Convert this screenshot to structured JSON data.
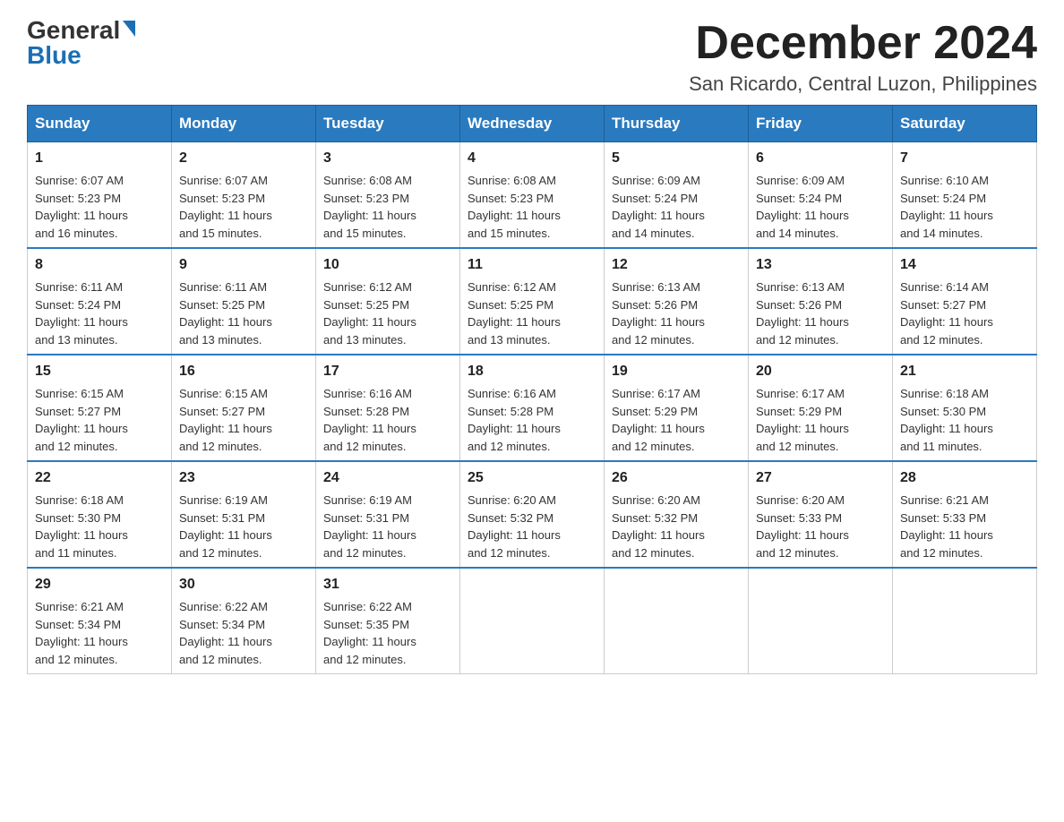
{
  "logo": {
    "general": "General",
    "blue": "Blue"
  },
  "header": {
    "month_year": "December 2024",
    "location": "San Ricardo, Central Luzon, Philippines"
  },
  "days_of_week": [
    "Sunday",
    "Monday",
    "Tuesday",
    "Wednesday",
    "Thursday",
    "Friday",
    "Saturday"
  ],
  "weeks": [
    [
      {
        "day": "1",
        "sunrise": "6:07 AM",
        "sunset": "5:23 PM",
        "daylight": "11 hours and 16 minutes."
      },
      {
        "day": "2",
        "sunrise": "6:07 AM",
        "sunset": "5:23 PM",
        "daylight": "11 hours and 15 minutes."
      },
      {
        "day": "3",
        "sunrise": "6:08 AM",
        "sunset": "5:23 PM",
        "daylight": "11 hours and 15 minutes."
      },
      {
        "day": "4",
        "sunrise": "6:08 AM",
        "sunset": "5:23 PM",
        "daylight": "11 hours and 15 minutes."
      },
      {
        "day": "5",
        "sunrise": "6:09 AM",
        "sunset": "5:24 PM",
        "daylight": "11 hours and 14 minutes."
      },
      {
        "day": "6",
        "sunrise": "6:09 AM",
        "sunset": "5:24 PM",
        "daylight": "11 hours and 14 minutes."
      },
      {
        "day": "7",
        "sunrise": "6:10 AM",
        "sunset": "5:24 PM",
        "daylight": "11 hours and 14 minutes."
      }
    ],
    [
      {
        "day": "8",
        "sunrise": "6:11 AM",
        "sunset": "5:24 PM",
        "daylight": "11 hours and 13 minutes."
      },
      {
        "day": "9",
        "sunrise": "6:11 AM",
        "sunset": "5:25 PM",
        "daylight": "11 hours and 13 minutes."
      },
      {
        "day": "10",
        "sunrise": "6:12 AM",
        "sunset": "5:25 PM",
        "daylight": "11 hours and 13 minutes."
      },
      {
        "day": "11",
        "sunrise": "6:12 AM",
        "sunset": "5:25 PM",
        "daylight": "11 hours and 13 minutes."
      },
      {
        "day": "12",
        "sunrise": "6:13 AM",
        "sunset": "5:26 PM",
        "daylight": "11 hours and 12 minutes."
      },
      {
        "day": "13",
        "sunrise": "6:13 AM",
        "sunset": "5:26 PM",
        "daylight": "11 hours and 12 minutes."
      },
      {
        "day": "14",
        "sunrise": "6:14 AM",
        "sunset": "5:27 PM",
        "daylight": "11 hours and 12 minutes."
      }
    ],
    [
      {
        "day": "15",
        "sunrise": "6:15 AM",
        "sunset": "5:27 PM",
        "daylight": "11 hours and 12 minutes."
      },
      {
        "day": "16",
        "sunrise": "6:15 AM",
        "sunset": "5:27 PM",
        "daylight": "11 hours and 12 minutes."
      },
      {
        "day": "17",
        "sunrise": "6:16 AM",
        "sunset": "5:28 PM",
        "daylight": "11 hours and 12 minutes."
      },
      {
        "day": "18",
        "sunrise": "6:16 AM",
        "sunset": "5:28 PM",
        "daylight": "11 hours and 12 minutes."
      },
      {
        "day": "19",
        "sunrise": "6:17 AM",
        "sunset": "5:29 PM",
        "daylight": "11 hours and 12 minutes."
      },
      {
        "day": "20",
        "sunrise": "6:17 AM",
        "sunset": "5:29 PM",
        "daylight": "11 hours and 12 minutes."
      },
      {
        "day": "21",
        "sunrise": "6:18 AM",
        "sunset": "5:30 PM",
        "daylight": "11 hours and 11 minutes."
      }
    ],
    [
      {
        "day": "22",
        "sunrise": "6:18 AM",
        "sunset": "5:30 PM",
        "daylight": "11 hours and 11 minutes."
      },
      {
        "day": "23",
        "sunrise": "6:19 AM",
        "sunset": "5:31 PM",
        "daylight": "11 hours and 12 minutes."
      },
      {
        "day": "24",
        "sunrise": "6:19 AM",
        "sunset": "5:31 PM",
        "daylight": "11 hours and 12 minutes."
      },
      {
        "day": "25",
        "sunrise": "6:20 AM",
        "sunset": "5:32 PM",
        "daylight": "11 hours and 12 minutes."
      },
      {
        "day": "26",
        "sunrise": "6:20 AM",
        "sunset": "5:32 PM",
        "daylight": "11 hours and 12 minutes."
      },
      {
        "day": "27",
        "sunrise": "6:20 AM",
        "sunset": "5:33 PM",
        "daylight": "11 hours and 12 minutes."
      },
      {
        "day": "28",
        "sunrise": "6:21 AM",
        "sunset": "5:33 PM",
        "daylight": "11 hours and 12 minutes."
      }
    ],
    [
      {
        "day": "29",
        "sunrise": "6:21 AM",
        "sunset": "5:34 PM",
        "daylight": "11 hours and 12 minutes."
      },
      {
        "day": "30",
        "sunrise": "6:22 AM",
        "sunset": "5:34 PM",
        "daylight": "11 hours and 12 minutes."
      },
      {
        "day": "31",
        "sunrise": "6:22 AM",
        "sunset": "5:35 PM",
        "daylight": "11 hours and 12 minutes."
      },
      null,
      null,
      null,
      null
    ]
  ],
  "labels": {
    "sunrise": "Sunrise:",
    "sunset": "Sunset:",
    "daylight": "Daylight:"
  }
}
